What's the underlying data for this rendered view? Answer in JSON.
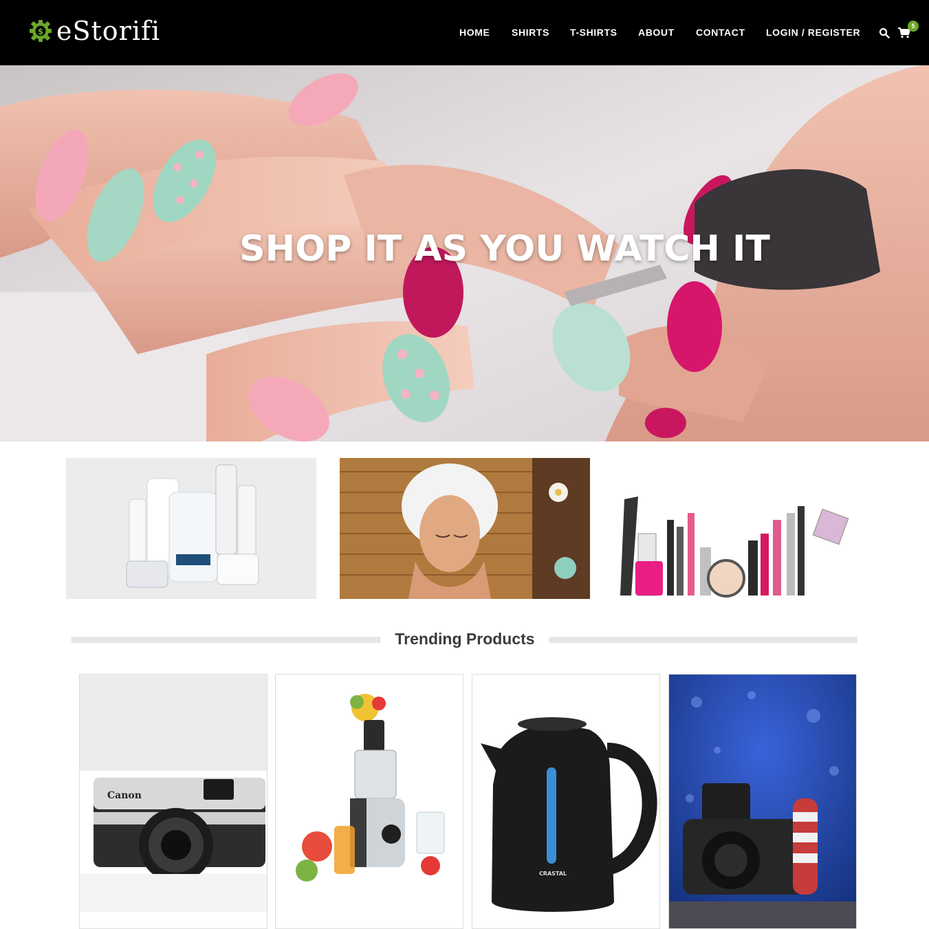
{
  "header": {
    "logo_text": "eStorifi",
    "logo_icon": "dollar-gear-icon",
    "nav": [
      {
        "label": "HOME"
      },
      {
        "label": "SHIRTS"
      },
      {
        "label": "T-SHIRTS"
      },
      {
        "label": "ABOUT"
      },
      {
        "label": "CONTACT"
      },
      {
        "label": "LOGIN / REGISTER"
      }
    ],
    "search_icon": "search-icon",
    "cart_icon": "cart-icon",
    "cart_count": "5"
  },
  "hero": {
    "title": "SHOP IT AS YOU WATCH IT"
  },
  "promos": [
    {
      "name": "skincare-products"
    },
    {
      "name": "spa-facial"
    },
    {
      "name": "makeup-collection"
    }
  ],
  "trending": {
    "title": "Trending Products",
    "products": [
      {
        "name": "canon-camera",
        "brand_mark": "Canon"
      },
      {
        "name": "juicer"
      },
      {
        "name": "electric-kettle",
        "brand_mark": "CRASTAL"
      },
      {
        "name": "dslr-camera"
      }
    ]
  },
  "colors": {
    "header_bg": "#000000",
    "accent": "#6aa827",
    "heading_text": "#3b3b3b"
  }
}
